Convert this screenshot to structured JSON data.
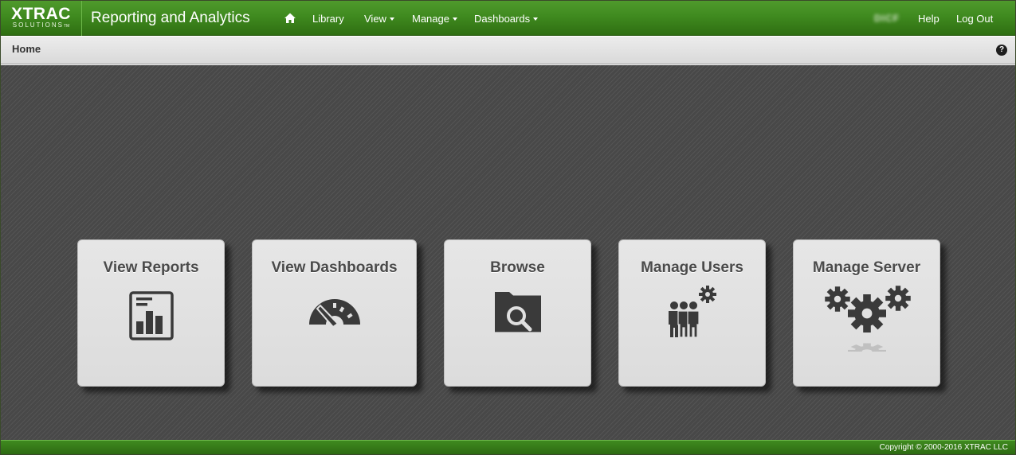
{
  "header": {
    "logo_main": "XTRAC",
    "logo_sub": "SOLUTIONS",
    "logo_tm": "TM",
    "app_title": "Reporting and Analytics",
    "nav": [
      {
        "label": "Library",
        "dropdown": false
      },
      {
        "label": "View",
        "dropdown": true
      },
      {
        "label": "Manage",
        "dropdown": true
      },
      {
        "label": "Dashboards",
        "dropdown": true
      }
    ],
    "user": "DICF",
    "help": "Help",
    "logout": "Log Out",
    "home_icon": "home-icon"
  },
  "subbar": {
    "breadcrumb": "Home",
    "help_icon": "question-circle-icon"
  },
  "tiles": [
    {
      "label": "View Reports",
      "icon": "report-icon"
    },
    {
      "label": "View Dashboards",
      "icon": "speedometer-icon"
    },
    {
      "label": "Browse",
      "icon": "folder-search-icon"
    },
    {
      "label": "Manage Users",
      "icon": "users-gear-icon"
    },
    {
      "label": "Manage Server",
      "icon": "gears-icon"
    }
  ],
  "footer": {
    "copyright": "Copyright © 2000-2016 XTRAC LLC"
  },
  "colors": {
    "brand_green": "#3f8a1f",
    "tile_bg": "#e0e0e0",
    "icon_dark": "#3a3a3a",
    "canvas_bg": "#4b4b4b"
  }
}
